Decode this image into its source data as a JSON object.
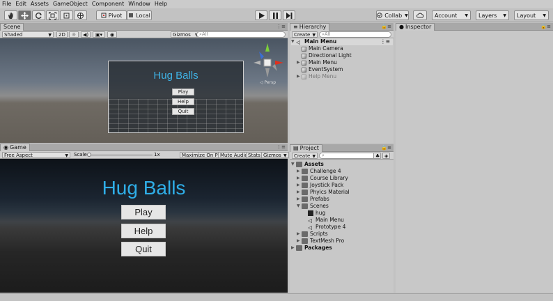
{
  "menu": [
    "File",
    "Edit",
    "Assets",
    "GameObject",
    "Component",
    "Window",
    "Help"
  ],
  "toolbar": {
    "tools": [
      "hand-tool",
      "move-tool",
      "rotate-tool",
      "scale-tool",
      "rect-tool",
      "transform-tool"
    ],
    "pivot_label": "Pivot",
    "local_label": "Local",
    "collab_label": "Collab",
    "account_label": "Account",
    "layers_label": "Layers",
    "layout_label": "Layout"
  },
  "scene": {
    "tab": "Scene",
    "shading": "Shaded",
    "mode_2d": "2D",
    "gizmos": "Gizmos",
    "search_placeholder": "All",
    "canvas_title": "Hug Balls",
    "buttons": [
      "Play",
      "Help",
      "Quit"
    ]
  },
  "game": {
    "tab": "Game",
    "aspect": "Free Aspect",
    "scale_label": "Scale",
    "scale_value": "1x",
    "maximize": "Maximize On Play",
    "mute": "Mute Audio",
    "stats": "Stats",
    "gizmos": "Gizmos",
    "title": "Hug Balls",
    "buttons": [
      "Play",
      "Help",
      "Quit"
    ]
  },
  "hierarchy": {
    "tab": "Hierarchy",
    "create": "Create",
    "search_placeholder": "All",
    "scene_name": "Main Menu",
    "items": [
      "Main Camera",
      "Directional Light",
      "Main Menu",
      "EventSystem",
      "Help Menu"
    ]
  },
  "project": {
    "tab": "Project",
    "create": "Create",
    "root": "Assets",
    "folders": [
      "Challenge 4",
      "Course Library",
      "Joystick Pack",
      "Phyics Material",
      "Prefabs",
      "Scenes"
    ],
    "scene_items": [
      "hug",
      "Main Menu",
      "Prototype 4"
    ],
    "folders_after": [
      "Scripts",
      "TextMesh Pro"
    ],
    "packages": "Packages"
  },
  "inspector": {
    "tab": "Inspector"
  },
  "colors": {
    "title_blue": "#2faee8",
    "gizmo_x": "#e0301e",
    "gizmo_y": "#7ccf3a",
    "gizmo_z": "#3a6fd6"
  }
}
